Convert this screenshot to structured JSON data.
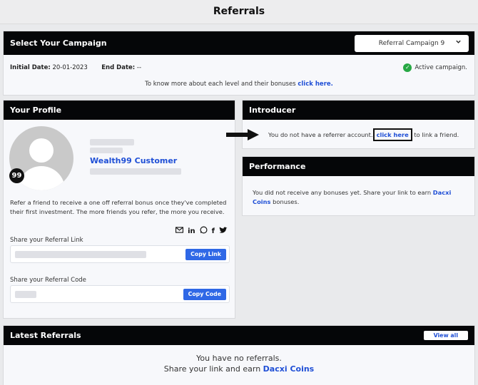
{
  "page": {
    "title": "Referrals"
  },
  "campaign": {
    "header": "Select Your Campaign",
    "selected": "Referral Campaign 9",
    "initial_date_label": "Initial Date:",
    "initial_date": "20-01-2023",
    "end_date_label": "End Date:",
    "end_date": "--",
    "status": "Active campaign.",
    "know_more_text": "To know more about each level and their bonuses",
    "know_more_link": "click here."
  },
  "profile": {
    "header": "Your Profile",
    "avatar_badge": "99",
    "name": "Wealth99 Customer",
    "description": "Refer a friend to receive a one off referral bonus once they've completed their first investment. The more friends you refer, the more you receive.",
    "socials": [
      "email-icon",
      "linkedin-icon",
      "whatsapp-icon",
      "facebook-icon",
      "twitter-icon"
    ],
    "share_link_label": "Share your Referral Link",
    "copy_link_button": "Copy Link",
    "share_code_label": "Share your Referral Code",
    "copy_code_button": "Copy Code"
  },
  "introducer": {
    "header": "Introducer",
    "text_before": "You do not have a referrer account.",
    "link": "click here",
    "text_after": " to link a friend."
  },
  "performance": {
    "header": "Performance",
    "text_before": "You did not receive any bonuses yet. Share your link to earn ",
    "link": "Dacxi Coins",
    "text_after": " bonuses."
  },
  "latest": {
    "header": "Latest Referrals",
    "view_all": "View all",
    "line1": "You have no referrals.",
    "line2_before": "Share your link and earn ",
    "line2_link": "Dacxi Coins"
  },
  "colors": {
    "accent": "#2f68e6",
    "header_bg": "#050608",
    "success": "#27a844"
  }
}
